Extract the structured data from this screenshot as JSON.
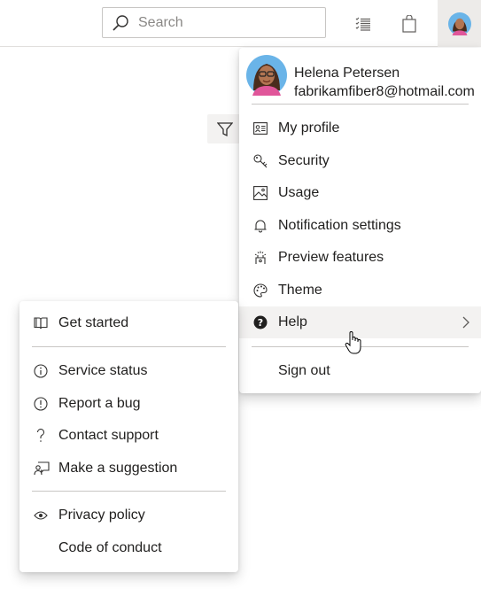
{
  "search": {
    "placeholder": "Search"
  },
  "topbar": {
    "icons": [
      "search-icon",
      "task-list-icon",
      "shopping-bag-icon",
      "avatar"
    ]
  },
  "profile_menu": {
    "user_name": "Helena Petersen",
    "user_email": "fabrikamfiber8@hotmail.com",
    "items": [
      {
        "label": "My profile",
        "icon": "contact-card-icon"
      },
      {
        "label": "Security",
        "icon": "key-icon"
      },
      {
        "label": "Usage",
        "icon": "picture-icon"
      },
      {
        "label": "Notification settings",
        "icon": "bell-icon"
      },
      {
        "label": "Preview features",
        "icon": "preview-sparkle-icon"
      },
      {
        "label": "Theme",
        "icon": "palette-icon"
      },
      {
        "label": "Help",
        "icon": "help-circle-icon",
        "hovered": true
      }
    ],
    "sign_out_label": "Sign out"
  },
  "help_menu": {
    "items": [
      {
        "label": "Get started",
        "icon": "book-icon"
      },
      {
        "label": "Service status",
        "icon": "info-icon"
      },
      {
        "label": "Report a bug",
        "icon": "alert-icon"
      },
      {
        "label": "Contact support",
        "icon": "question-icon"
      },
      {
        "label": "Make a suggestion",
        "icon": "feedback-icon"
      },
      {
        "label": "Privacy policy",
        "icon": "eye-icon"
      },
      {
        "label": "Code of conduct",
        "icon": ""
      }
    ]
  },
  "colors": {
    "hover_bg": "#f3f2f1",
    "divider": "#c8c6c4",
    "text": "#201f1e",
    "avatar_ring": "#6ab4e8"
  }
}
